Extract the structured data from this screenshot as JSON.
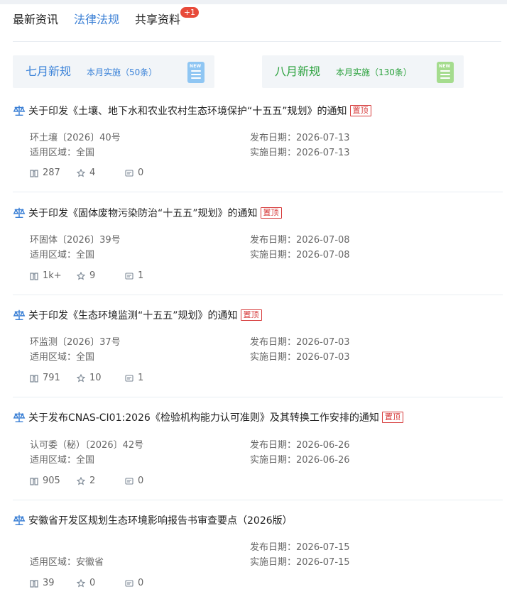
{
  "tabs": [
    {
      "label": "最新资讯"
    },
    {
      "label": "法律法规"
    },
    {
      "label": "共享资料",
      "badge": "+1"
    }
  ],
  "active_tab": "法律法规",
  "cards": [
    {
      "title": "七月新规",
      "sub": "本月实施（50条）",
      "color": "#3a82d8",
      "icon_text": "NEW"
    },
    {
      "title": "八月新规",
      "sub": "本月实施（130条）",
      "color": "#2aa13c",
      "icon_text": "NEW"
    }
  ],
  "labels": {
    "published": "发布日期：",
    "effective": "实施日期：",
    "region": "适用区域：",
    "pinned": "置顶"
  },
  "articles": [
    {
      "title": "关于印发《土壤、地下水和农业农村生态环境保护“十五五”规划》的通知",
      "pinned": true,
      "doc_no": "环土壤〔2026〕40号",
      "region": "全国",
      "published": "2026-07-13",
      "effective": "2026-07-13",
      "views": "287",
      "stars": "4",
      "comments": "0"
    },
    {
      "title": "关于印发《固体废物污染防治“十五五”规划》的通知",
      "pinned": true,
      "doc_no": "环固体〔2026〕39号",
      "region": "全国",
      "published": "2026-07-08",
      "effective": "2026-07-08",
      "views": "1k+",
      "stars": "9",
      "comments": "1"
    },
    {
      "title": "关于印发《生态环境监测“十五五”规划》的通知",
      "pinned": true,
      "doc_no": "环监测〔2026〕37号",
      "region": "全国",
      "published": "2026-07-03",
      "effective": "2026-07-03",
      "views": "791",
      "stars": "10",
      "comments": "1"
    },
    {
      "title": "关于发布CNAS-CI01:2026《检验机构能力认可准则》及其转换工作安排的通知",
      "pinned": true,
      "doc_no": "认可委（秘）〔2026〕42号",
      "region": "全国",
      "published": "2026-06-26",
      "effective": "2026-06-26",
      "views": "905",
      "stars": "2",
      "comments": "0"
    },
    {
      "title": "安徽省开发区规划生态环境影响报告书审查要点（2026版）",
      "pinned": false,
      "doc_no": "",
      "region": "安徽省",
      "published": "2026-07-15",
      "effective": "2026-07-15",
      "views": "39",
      "stars": "0",
      "comments": "0"
    }
  ]
}
